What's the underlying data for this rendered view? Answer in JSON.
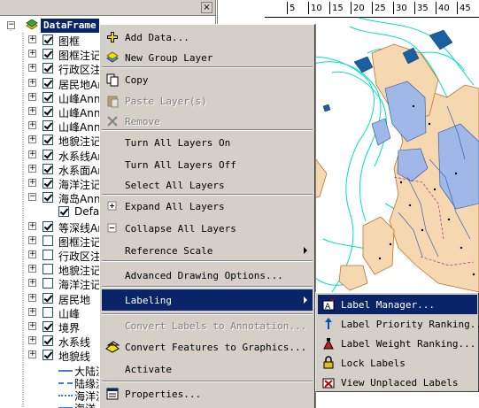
{
  "toc": {
    "close_glyph": "×",
    "dataframe_label": "DataFrame",
    "layers": [
      {
        "name": "图框",
        "checked": true
      },
      {
        "name": "图框注记",
        "checked": true
      },
      {
        "name": "行政区注",
        "checked": true
      },
      {
        "name": "居民地An",
        "checked": true
      },
      {
        "name": "山峰Anno",
        "checked": true
      },
      {
        "name": "山峰Anno",
        "checked": true
      },
      {
        "name": "山峰Anno",
        "checked": true
      },
      {
        "name": "地貌注记",
        "checked": true
      },
      {
        "name": "水系线An",
        "checked": true
      },
      {
        "name": "水系面An",
        "checked": true
      },
      {
        "name": "海洋注记",
        "checked": true
      },
      {
        "name": "海岛Anno",
        "checked": true
      },
      {
        "name": "Defau",
        "checked": true
      },
      {
        "name": "等深线An",
        "checked": true
      },
      {
        "name": "图框注记",
        "checked": false
      },
      {
        "name": "行政区注",
        "checked": false
      },
      {
        "name": "地貌注记",
        "checked": false
      },
      {
        "name": "海洋注记",
        "checked": false
      },
      {
        "name": "居民地",
        "checked": true
      },
      {
        "name": "山峰",
        "checked": false
      },
      {
        "name": "境界",
        "checked": true
      },
      {
        "name": "水系线",
        "checked": true
      },
      {
        "name": "地貌线",
        "checked": true
      }
    ],
    "legend": [
      {
        "name": "大陆流",
        "color": "#3b7fd6",
        "style": "solid"
      },
      {
        "name": "陆缘流",
        "color": "#3b7fd6",
        "style": "dashed"
      },
      {
        "name": "海洋流",
        "color": "#3b7fd6",
        "style": "wavy"
      },
      {
        "name": "海洋",
        "color": "#3b7fd6",
        "style": "solid"
      }
    ]
  },
  "ruler": {
    "ticks": [
      "5",
      "10",
      "15",
      "20",
      "25",
      "30",
      "35",
      "40",
      "45"
    ]
  },
  "context_menu": {
    "items": [
      {
        "label": "Add Data...",
        "underline": "Add",
        "icon": "add-data-icon",
        "disabled": false
      },
      {
        "label": "New Group Layer",
        "underline": "",
        "icon": "group-layer-icon",
        "disabled": false
      },
      {
        "label": "Copy",
        "underline": "C",
        "icon": "copy-icon",
        "disabled": false
      },
      {
        "label": "Paste Layer(s)",
        "underline": "P",
        "icon": "paste-icon",
        "disabled": true
      },
      {
        "label": "Remove",
        "underline": "R",
        "icon": "remove-icon",
        "disabled": true
      },
      {
        "label": "Turn All Layers On",
        "underline": "",
        "icon": "",
        "disabled": false
      },
      {
        "label": "Turn All Layers Off",
        "underline": "",
        "icon": "",
        "disabled": false
      },
      {
        "label": "Select All Layers",
        "underline": "",
        "icon": "",
        "disabled": false
      },
      {
        "label": "Expand All Layers",
        "underline": "",
        "icon": "expand-icon",
        "disabled": false
      },
      {
        "label": "Collapse All Layers",
        "underline": "",
        "icon": "collapse-icon",
        "disabled": false
      },
      {
        "label": "Reference Scale",
        "underline": "",
        "icon": "",
        "disabled": false,
        "submenu": true
      },
      {
        "label": "Advanced Drawing Options...",
        "underline": "",
        "icon": "",
        "disabled": false
      },
      {
        "label": "Labeling",
        "underline": "",
        "icon": "",
        "disabled": false,
        "submenu": true,
        "active": true
      },
      {
        "label": "Convert Labels to Annotation...",
        "underline": "",
        "icon": "",
        "disabled": true
      },
      {
        "label": "Convert Features to Graphics...",
        "underline": "",
        "icon": "convert-features-icon",
        "disabled": false
      },
      {
        "label": "Activate",
        "underline": "",
        "icon": "",
        "disabled": false
      },
      {
        "label": "Properties...",
        "underline": "",
        "icon": "properties-icon",
        "disabled": false
      }
    ]
  },
  "labeling_submenu": {
    "items": [
      {
        "label": "Label Manager...",
        "icon": "label-manager-icon",
        "active": true
      },
      {
        "label": "Label Priority Ranking...",
        "icon": "priority-ranking-icon",
        "active": false
      },
      {
        "label": "Label Weight Ranking...",
        "icon": "weight-ranking-icon",
        "active": false
      },
      {
        "label": "Lock Labels",
        "icon": "lock-labels-icon",
        "active": false
      },
      {
        "label": "View Unplaced Labels",
        "icon": "unplaced-labels-icon",
        "active": false
      }
    ]
  },
  "colors": {
    "highlight": "#0a246a",
    "menu_bg": "#d4d0c8",
    "water_line": "#00e0c0",
    "land": "#f6d8b0",
    "sea_fill": "#9fb8e8"
  }
}
